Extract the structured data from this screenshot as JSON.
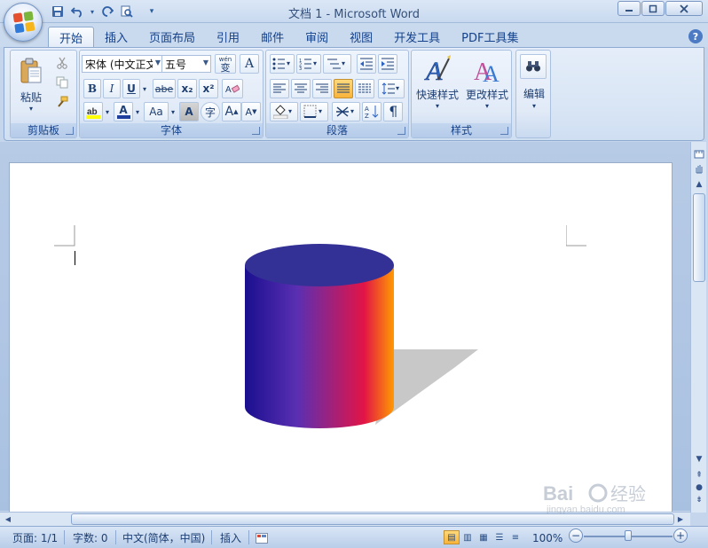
{
  "window": {
    "title": "文档 1 - Microsoft Word",
    "minimize_icon": "minimize-icon",
    "maximize_icon": "maximize-icon",
    "close_icon": "close-icon"
  },
  "quick_access": [
    "save-icon",
    "undo-icon",
    "redo-icon",
    "print-preview-icon",
    "customize-icon"
  ],
  "tabs": [
    {
      "label": "开始",
      "active": true
    },
    {
      "label": "插入"
    },
    {
      "label": "页面布局"
    },
    {
      "label": "引用"
    },
    {
      "label": "邮件"
    },
    {
      "label": "审阅"
    },
    {
      "label": "视图"
    },
    {
      "label": "开发工具"
    },
    {
      "label": "PDF工具集"
    }
  ],
  "ribbon": {
    "clipboard": {
      "label": "剪贴板",
      "paste_label": "粘贴"
    },
    "font": {
      "label": "字体",
      "font_name": "宋体 (中文正文)",
      "font_size": "五号",
      "bold": "B",
      "italic": "I",
      "underline": "U",
      "strikethrough": "abe",
      "subscript": "x₂",
      "superscript": "x²",
      "grow_font": "A",
      "shrink_font": "A",
      "change_case": "Aa",
      "font_color": "A",
      "char_shading": "A",
      "enclose_char": "字",
      "phonetic": "wén",
      "phonetic_char": "变"
    },
    "paragraph": {
      "label": "段落"
    },
    "styles": {
      "label": "样式",
      "quick_styles": "快速样式",
      "change_styles": "更改样式"
    },
    "editing": {
      "label": "编辑"
    }
  },
  "document": {
    "shape": "cylinder",
    "gradient_colors": [
      "#1f0a8c",
      "#6e2ab6",
      "#e0104a",
      "#ff8a00"
    ],
    "top_color": "#3a3699",
    "shadow_color": "#c8c8c8"
  },
  "status": {
    "page": "页面: 1/1",
    "words": "字数: 0",
    "language": "中文(简体，中国)",
    "mode": "插入",
    "zoom": "100%",
    "zoom_value": 100
  },
  "watermark": {
    "brand": "Bai",
    "brand2": "经验",
    "url": "jingyan.baidu.com"
  }
}
